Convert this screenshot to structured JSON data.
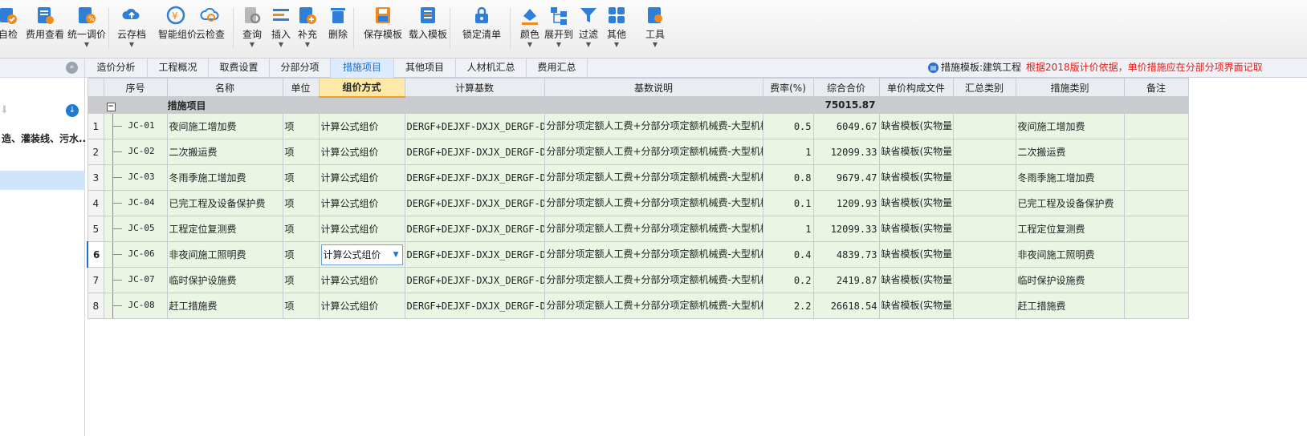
{
  "toolbar": {
    "buttons": [
      {
        "label": "自检",
        "icon": "self-check-icon",
        "caret": false
      },
      {
        "label": "费用查看",
        "icon": "cost-view-icon",
        "caret": false
      },
      {
        "label": "统一调价",
        "icon": "unified-price-icon",
        "caret": true
      },
      {
        "label": "云存档",
        "icon": "cloud-save-icon",
        "caret": true
      },
      {
        "label": "智能组价",
        "icon": "smart-pricing-icon",
        "caret": false
      },
      {
        "label": "云检查",
        "icon": "cloud-check-icon",
        "caret": false
      },
      {
        "label": "查询",
        "icon": "query-icon",
        "caret": true
      },
      {
        "label": "插入",
        "icon": "insert-icon",
        "caret": true
      },
      {
        "label": "补充",
        "icon": "supplement-icon",
        "caret": true
      },
      {
        "label": "删除",
        "icon": "delete-icon",
        "caret": false
      },
      {
        "label": "保存模板",
        "icon": "save-template-icon",
        "caret": false
      },
      {
        "label": "载入模板",
        "icon": "load-template-icon",
        "caret": false
      },
      {
        "label": "锁定清单",
        "icon": "lock-icon",
        "caret": false
      },
      {
        "label": "颜色",
        "icon": "color-icon",
        "caret": true
      },
      {
        "label": "展开到",
        "icon": "expand-to-icon",
        "caret": true
      },
      {
        "label": "过滤",
        "icon": "filter-icon",
        "caret": true
      },
      {
        "label": "其他",
        "icon": "other-icon",
        "caret": true
      },
      {
        "label": "工具",
        "icon": "tools-icon",
        "caret": true
      }
    ]
  },
  "left_panel": {
    "node_label": "造、灌装线、污水..."
  },
  "tabs": [
    {
      "label": "造价分析",
      "active": false
    },
    {
      "label": "工程概况",
      "active": false
    },
    {
      "label": "取费设置",
      "active": false
    },
    {
      "label": "分部分项",
      "active": false
    },
    {
      "label": "措施项目",
      "active": true
    },
    {
      "label": "其他项目",
      "active": false
    },
    {
      "label": "人材机汇总",
      "active": false
    },
    {
      "label": "费用汇总",
      "active": false
    }
  ],
  "notice": {
    "template": "措施模板:建筑工程",
    "warning": "根据2018版计价依据，单价措施应在分部分项界面记取"
  },
  "grid": {
    "columns": [
      "",
      "序号",
      "名称",
      "单位",
      "组价方式",
      "计算基数",
      "基数说明",
      "费率(%)",
      "综合合价",
      "单价构成文件",
      "汇总类别",
      "措施类别",
      "备注"
    ],
    "group": {
      "expander": "−",
      "name": "措施项目",
      "total": "75015.87"
    },
    "rows": [
      {
        "num": "1",
        "code": "JC-01",
        "name": "夜间施工增加费",
        "unit": "项",
        "method": "计算公式组价",
        "base": "DERGF+DEJXF-DXJX_DERGF-DXJX_DEJXF",
        "desc": "分部分项定额人工费+分部分项定额机械费-大型机械子目定额人工费-大型机械子目定额机械费",
        "rate": "0.5",
        "total": "6049.67",
        "file": "缺省模板(实物量或计算公式组价)",
        "summary": "",
        "category": "夜间施工增加费",
        "remark": ""
      },
      {
        "num": "2",
        "code": "JC-02",
        "name": "二次搬运费",
        "unit": "项",
        "method": "计算公式组价",
        "base": "DERGF+DEJXF-DXJX_DERGF-DXJX_DEJXF",
        "desc": "分部分项定额人工费+分部分项定额机械费-大型机械子目定额人工费-大型机械子目定额机械费",
        "rate": "1",
        "total": "12099.33",
        "file": "缺省模板(实物量或计算公式组价)",
        "summary": "",
        "category": "二次搬运费",
        "remark": ""
      },
      {
        "num": "3",
        "code": "JC-03",
        "name": "冬雨季施工增加费",
        "unit": "项",
        "method": "计算公式组价",
        "base": "DERGF+DEJXF-DXJX_DERGF-DXJX_DEJXF",
        "desc": "分部分项定额人工费+分部分项定额机械费-大型机械子目定额人工费-大型机械子目定额机械费",
        "rate": "0.8",
        "total": "9679.47",
        "file": "缺省模板(实物量或计算公式组价)",
        "summary": "",
        "category": "冬雨季施工增加费",
        "remark": ""
      },
      {
        "num": "4",
        "code": "JC-04",
        "name": "已完工程及设备保护费",
        "unit": "项",
        "method": "计算公式组价",
        "base": "DERGF+DEJXF-DXJX_DERGF-DXJX_DEJXF",
        "desc": "分部分项定额人工费+分部分项定额机械费-大型机械子目定额人工费-大型机械子目定额机械费",
        "rate": "0.1",
        "total": "1209.93",
        "file": "缺省模板(实物量或计算公式组价)",
        "summary": "",
        "category": "已完工程及设备保护费",
        "remark": ""
      },
      {
        "num": "5",
        "code": "JC-05",
        "name": "工程定位复测费",
        "unit": "项",
        "method": "计算公式组价",
        "base": "DERGF+DEJXF-DXJX_DERGF-DXJX_DEJXF",
        "desc": "分部分项定额人工费+分部分项定额机械费-大型机械子目定额人工费-大型机械子目定额机械费",
        "rate": "1",
        "total": "12099.33",
        "file": "缺省模板(实物量或计算公式组价)",
        "summary": "",
        "category": "工程定位复测费",
        "remark": ""
      },
      {
        "num": "6",
        "code": "JC-06",
        "name": "非夜间施工照明费",
        "unit": "项",
        "method": "计算公式组价",
        "base": "DERGF+DEJXF-DXJX_DERGF-DXJX_DEJXF",
        "desc": "分部分项定额人工费+分部分项定额机械费-大型机械子目定额人工费-大型机械子目定额机械费",
        "rate": "0.4",
        "total": "4839.73",
        "file": "缺省模板(实物量或计算公式组价)",
        "summary": "",
        "category": "非夜间施工照明费",
        "remark": "",
        "selected": true
      },
      {
        "num": "7",
        "code": "JC-07",
        "name": "临时保护设施费",
        "unit": "项",
        "method": "计算公式组价",
        "base": "DERGF+DEJXF-DXJX_DERGF-DXJX_DEJXF",
        "desc": "分部分项定额人工费+分部分项定额机械费-大型机械子目定额人工费-大型机械子目定额机械费",
        "rate": "0.2",
        "total": "2419.87",
        "file": "缺省模板(实物量或计算公式组价)",
        "summary": "",
        "category": "临时保护设施费",
        "remark": ""
      },
      {
        "num": "8",
        "code": "JC-08",
        "name": "赶工措施费",
        "unit": "项",
        "method": "计算公式组价",
        "base": "DERGF+DEJXF-DXJX_DERGF-DXJX_DEJXF",
        "desc": "分部分项定额人工费+分部分项定额机械费-大型机械子目定额人工费-大型机械子目定额机械费",
        "rate": "2.2",
        "total": "26618.54",
        "file": "缺省模板(实物量或计算公式组价)",
        "summary": "",
        "category": "赶工措施费",
        "remark": ""
      }
    ]
  },
  "colors": {
    "accent": "#1e6fd0",
    "warning": "#e0201a",
    "row_bg": "#eaf5e3",
    "header_highlight": "#ffe9a8"
  }
}
